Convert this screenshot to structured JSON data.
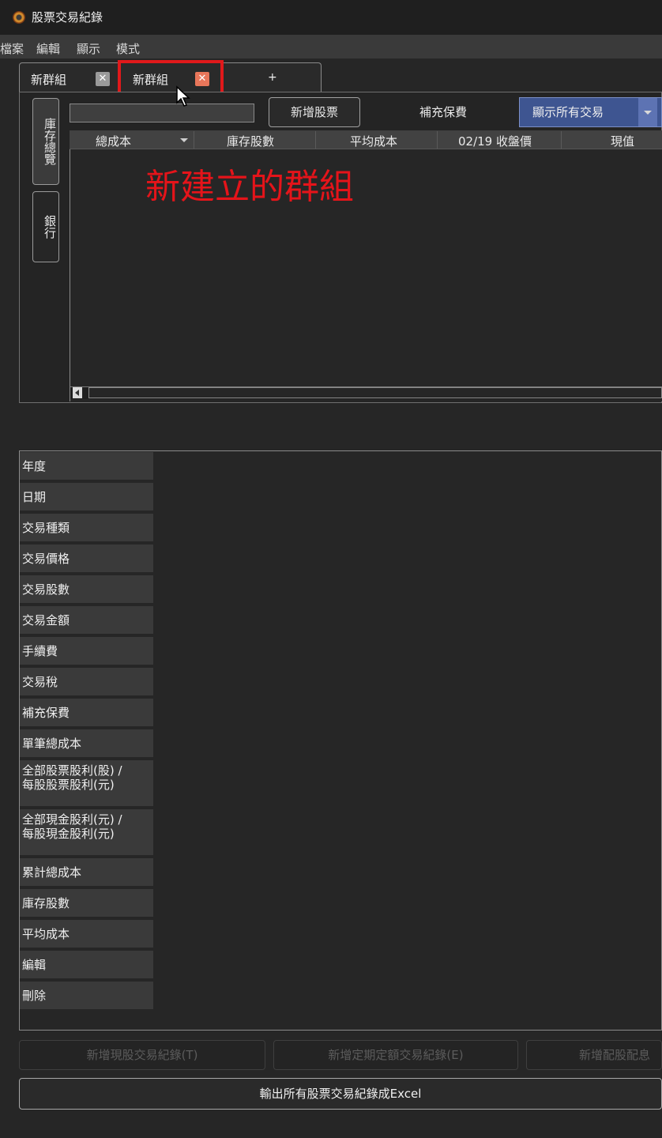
{
  "window": {
    "title": "股票交易紀錄"
  },
  "menu": [
    "檔案",
    "編輯",
    "顯示",
    "模式"
  ],
  "tabs": [
    {
      "label": "新群組",
      "close": "✕",
      "close_color": "#9a9a9a"
    },
    {
      "label": "新群組",
      "close": "✕",
      "close_color": "#e8765a"
    }
  ],
  "new_tab_label": "+",
  "side_tabs": [
    "庫存總覽",
    "銀行"
  ],
  "toolbar": {
    "add_stock_label": "新增股票",
    "supplement_label": "補充保費",
    "filter_value": "顯示所有交易"
  },
  "grid_columns": [
    "總成本",
    "庫存股數",
    "平均成本",
    "02/19 收盤價",
    "現值"
  ],
  "annotation": "新建立的群組",
  "detail_rows": [
    "年度",
    "日期",
    "交易種類",
    "交易價格",
    "交易股數",
    "交易金額",
    "手續費",
    "交易稅",
    "補充保費",
    "單筆總成本",
    "全部股票股利(股) / 每股股票股利(元)",
    "全部現金股利(元) / 每股現金股利(元)",
    "累計總成本",
    "庫存股數",
    "平均成本",
    "編輯",
    "刪除"
  ],
  "detail_rows_two_line": {
    "r10_a": "全部股票股利(股) /",
    "r10_b": "每股股票股利(元)",
    "r11_a": "全部現金股利(元) /",
    "r11_b": "每股現金股利(元)"
  },
  "actions": {
    "add_spot": "新增現股交易紀錄(T)",
    "add_periodic": "新增定期定額交易紀錄(E)",
    "add_rights": "新增配股配息",
    "export": "輸出所有股票交易紀錄成Excel"
  },
  "colors": {
    "accent_select": "#3e5591",
    "highlight_red": "#e0191b",
    "annotation_red": "#e5141a"
  }
}
